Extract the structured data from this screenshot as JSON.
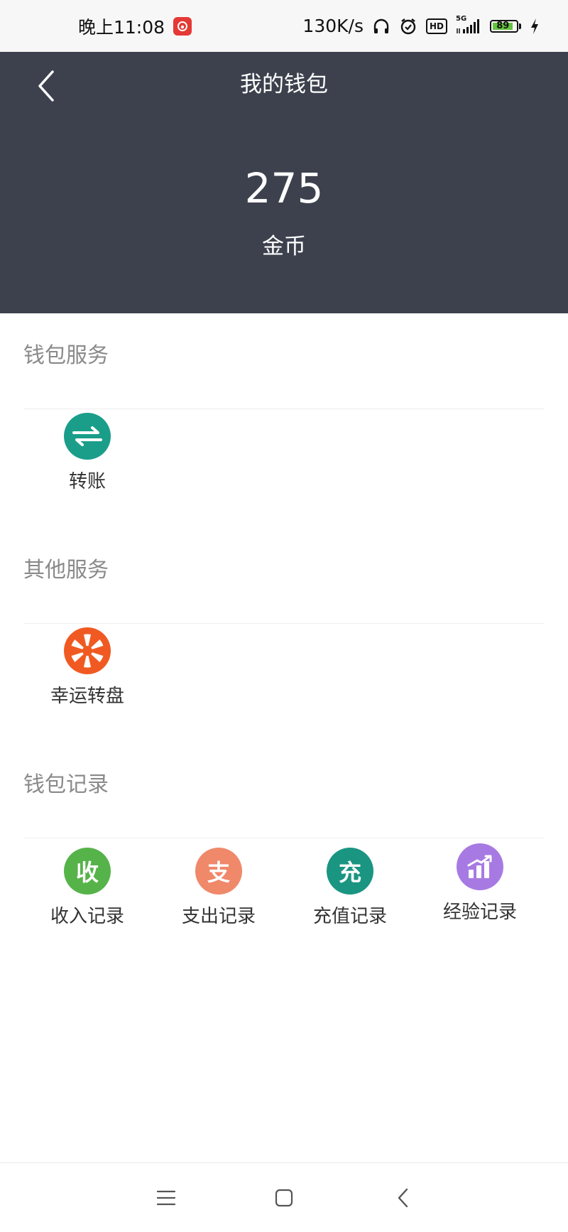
{
  "status_bar": {
    "time": "晚上11:08",
    "network_speed": "130K/s",
    "network_type": "5G",
    "hd_label": "HD",
    "battery_level": "89",
    "battery_percent": 89
  },
  "header": {
    "title": "我的钱包",
    "balance_value": "275",
    "balance_unit": "金币"
  },
  "sections": {
    "wallet_service": {
      "title": "钱包服务",
      "items": [
        {
          "label": "转账",
          "icon": "transfer-icon",
          "color": "#1a9e8a"
        }
      ]
    },
    "other_service": {
      "title": "其他服务",
      "items": [
        {
          "label": "幸运转盘",
          "icon": "lucky-wheel-icon",
          "color": "#f05a22"
        }
      ]
    },
    "wallet_records": {
      "title": "钱包记录",
      "items": [
        {
          "label": "收入记录",
          "glyph": "收",
          "icon": "income-icon",
          "color": "#56b349"
        },
        {
          "label": "支出记录",
          "glyph": "支",
          "icon": "expense-icon",
          "color": "#f0886a"
        },
        {
          "label": "充值记录",
          "glyph": "充",
          "icon": "recharge-icon",
          "color": "#1a9582"
        },
        {
          "label": "经验记录",
          "icon": "chart-icon",
          "color": "#a77ae3"
        }
      ]
    }
  },
  "colors": {
    "header_bg": "#3c414d",
    "section_title": "#8a8a8a"
  },
  "nav": {
    "icons": [
      "menu-icon",
      "home-icon",
      "back-icon"
    ]
  }
}
